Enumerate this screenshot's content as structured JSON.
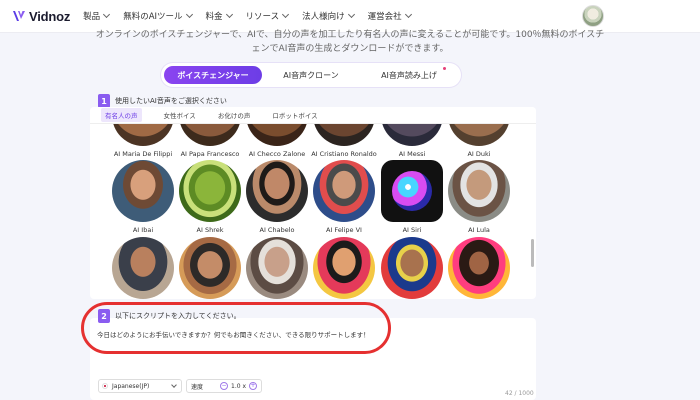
{
  "nav": {
    "brand": "Vidnoz",
    "items": [
      "製品",
      "無料のAIツール",
      "料金",
      "リソース",
      "法人様向け",
      "運営会社"
    ]
  },
  "intro": {
    "line1": "オンラインのボイスチェンジャーで、AIで、自分の声を加工したり有名人の声に変えることが可能です。100％無料のボイスチ",
    "line2": "ェンでAI音声の生成とダウンロードができます。"
  },
  "tabs": [
    "ボイスチェンジャー",
    "AI音声クローン",
    "AI音声読み上げ"
  ],
  "step1": {
    "number": "1",
    "label": "使用したいAI音声をご選択ください",
    "subtabs": [
      "有名人の声",
      "女性ボイス",
      "お化けの声",
      "ロボットボイス"
    ]
  },
  "voices": {
    "row1": [
      "AI Maria De Filippi",
      "AI Papa Francesco",
      "AI Checco Zalone",
      "AI Cristiano Ronaldo",
      "AI Messi",
      "AI Duki"
    ],
    "row2": [
      "AI Ibai",
      "AI Shrek",
      "AI Chabelo",
      "AI Felipe VI",
      "AI Siri",
      "AI Lula"
    ]
  },
  "step2": {
    "number": "2",
    "label": "以下にスクリプトを入力してください。",
    "script_text": "今日はどのようにお手伝いできますか？何でもお聞きください、できる限りサポートします！",
    "language": "Japanese(JP)",
    "speed_label": "速度",
    "speed_value": "1.0 x",
    "minus": "−",
    "plus": "+",
    "char_count": "42 / 1000"
  },
  "colors": {
    "accent": "#6d3de6",
    "highlight": "#e53030"
  }
}
